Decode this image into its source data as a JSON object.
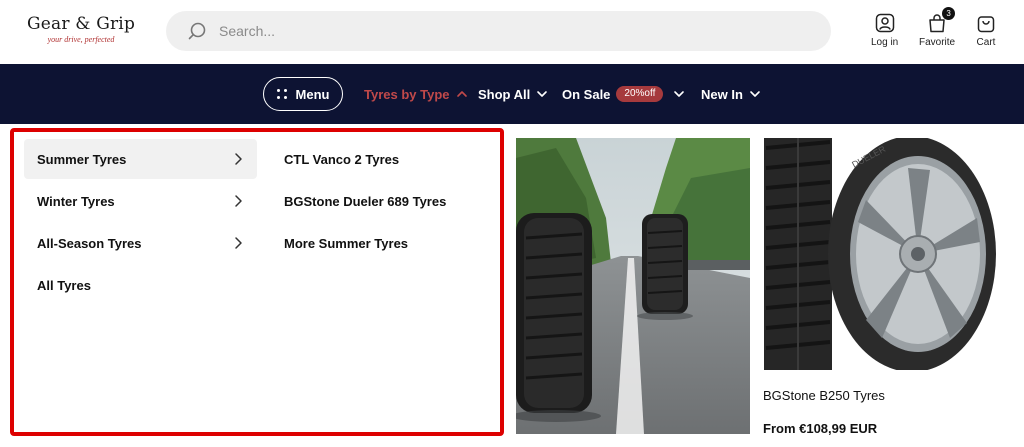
{
  "brand": {
    "name": "Gear & Grip",
    "tagline": "your drive, perfected"
  },
  "search": {
    "placeholder": "Search..."
  },
  "header_actions": {
    "login": {
      "label": "Log in",
      "icon": "user-icon"
    },
    "favorite": {
      "label": "Favorite",
      "icon": "heart-bag-icon",
      "count": "3"
    },
    "cart": {
      "label": "Cart",
      "icon": "shopping-bag-icon"
    }
  },
  "nav": {
    "menu_label": "Menu",
    "items": [
      {
        "label": "Tyres by Type",
        "state": "open"
      },
      {
        "label": "Shop All"
      },
      {
        "label": "On Sale",
        "badge": "20%off"
      },
      {
        "label": "New In"
      }
    ]
  },
  "dropdown": {
    "categories": [
      {
        "label": "Summer Tyres",
        "selected": true
      },
      {
        "label": "Winter Tyres"
      },
      {
        "label": "All-Season Tyres"
      },
      {
        "label": "All Tyres"
      }
    ],
    "subitems": [
      {
        "label": "CTL Vanco 2 Tyres"
      },
      {
        "label": "BGStone Dueler 689 Tyres"
      },
      {
        "label": "More Summer Tyres"
      }
    ]
  },
  "product": {
    "name": "BGStone B250 Tyres",
    "price": "From €108,99 EUR"
  },
  "colors": {
    "nav_bg": "#0d1333",
    "accent": "#c0494a",
    "sale_badge": "#a63a3d",
    "highlight_border": "#dd0000"
  }
}
